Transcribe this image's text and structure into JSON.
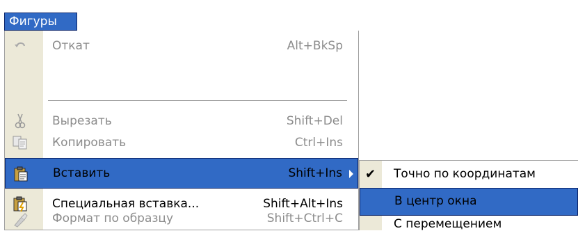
{
  "menubar": {
    "title": "Фигуры"
  },
  "menu": {
    "items": [
      {
        "label": "Откат",
        "shortcut": "Alt+BkSp",
        "icon": "undo-icon",
        "state": "disabled"
      },
      {
        "label": "Вырезать",
        "shortcut": "Shift+Del",
        "icon": "scissors-icon",
        "state": "disabled"
      },
      {
        "label": "Копировать",
        "shortcut": "Ctrl+Ins",
        "icon": "copy-icon",
        "state": "disabled"
      },
      {
        "label": "Вставить",
        "shortcut": "Shift+Ins",
        "icon": "paste-icon",
        "state": "highlighted",
        "has_submenu": true
      },
      {
        "label": "Специальная вставка...",
        "shortcut": "Shift+Alt+Ins",
        "icon": "paste-special-icon",
        "state": "enabled"
      },
      {
        "label": "Формат по образцу",
        "shortcut": "Shift+Ctrl+C",
        "icon": "format-painter-icon",
        "state": "disabled"
      }
    ]
  },
  "submenu": {
    "items": [
      {
        "label": "Точно по координатам",
        "checked": true,
        "state": "enabled"
      },
      {
        "label": "В центр окна",
        "checked": false,
        "state": "highlighted"
      },
      {
        "label": "С перемещением",
        "checked": false,
        "state": "enabled"
      }
    ]
  },
  "colors": {
    "highlight": "#316ac5",
    "icon_strip": "#ece9d8",
    "disabled_text": "#8c8c8c"
  }
}
